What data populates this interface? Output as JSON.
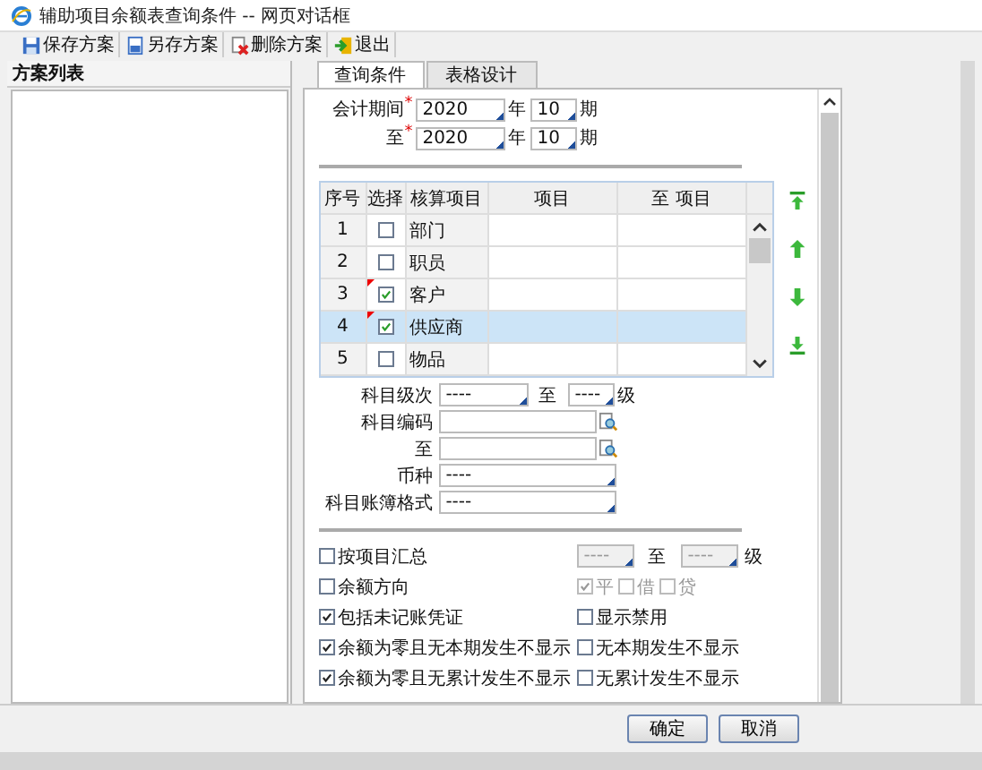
{
  "window": {
    "title": "辅助项目余额表查询条件 -- 网页对话框"
  },
  "toolbar": [
    {
      "kind": "save",
      "label": "保存方案"
    },
    {
      "kind": "saveas",
      "label": "另存方案"
    },
    {
      "kind": "delete",
      "label": "删除方案"
    },
    {
      "kind": "exit",
      "label": "退出"
    }
  ],
  "scheme_list": {
    "title": "方案列表"
  },
  "tabs": [
    {
      "label": "查询条件",
      "selected": true
    },
    {
      "label": "表格设计",
      "selected": false
    }
  ],
  "period": [
    {
      "label": "会计期间",
      "mark": "*",
      "year": "2020",
      "year_unit": "年",
      "period": "10",
      "period_unit": "期"
    },
    {
      "label": "至",
      "mark": "*",
      "year": "2020",
      "year_unit": "年",
      "period": "10",
      "period_unit": "期"
    }
  ],
  "table": {
    "columns": [
      "序号",
      "选择",
      "核算项目",
      "项目",
      "至 项目"
    ],
    "rows": [
      {
        "no": "1",
        "checked": false,
        "item": "部门",
        "flagged": false,
        "selected": false
      },
      {
        "no": "2",
        "checked": false,
        "item": "职员",
        "flagged": false,
        "selected": false
      },
      {
        "no": "3",
        "checked": true,
        "item": "客户",
        "flagged": true,
        "selected": false
      },
      {
        "no": "4",
        "checked": true,
        "item": "供应商",
        "flagged": true,
        "selected": true
      },
      {
        "no": "5",
        "checked": false,
        "item": "物品",
        "flagged": false,
        "selected": false
      }
    ]
  },
  "form": {
    "level": {
      "label": "科目级次",
      "from": "----",
      "to_label": "至",
      "to": "----",
      "unit": "级"
    },
    "code_from": {
      "label": "科目编码"
    },
    "code_to": {
      "label": "至"
    },
    "currency": {
      "label": "币种",
      "value": "----"
    },
    "format": {
      "label": "科目账簿格式",
      "value": "----"
    }
  },
  "summary": {
    "label": "按项目汇总",
    "checked": false,
    "from": "----",
    "to_label": "至",
    "to": "----",
    "unit": "级",
    "disabled": true
  },
  "direction": {
    "label": "余额方向",
    "checked": false,
    "choices": [
      {
        "label": "平",
        "checked": true,
        "disabled": true
      },
      {
        "label": "借",
        "checked": false,
        "disabled": true
      },
      {
        "label": "贷",
        "checked": false,
        "disabled": true
      }
    ]
  },
  "options": [
    {
      "label": "包括未记账凭证",
      "checked": true
    },
    {
      "label": "显示禁用",
      "checked": false
    },
    {
      "label": "余额为零且无本期发生不显示",
      "checked": true
    },
    {
      "label": "无本期发生不显示",
      "checked": false
    },
    {
      "label": "余额为零且无累计发生不显示",
      "checked": true
    },
    {
      "label": "无累计发生不显示",
      "checked": false
    }
  ],
  "buttons": [
    "确定",
    "取消"
  ]
}
